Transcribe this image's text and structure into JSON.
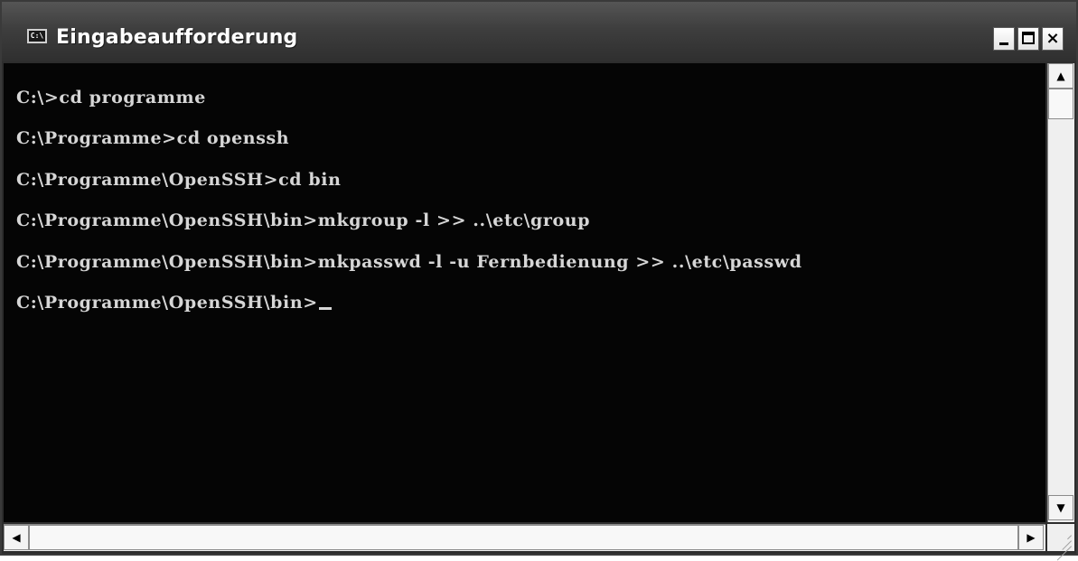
{
  "window": {
    "title": "Eingabeaufforderung",
    "icon_label": "C:\\",
    "controls": {
      "minimize_icon": "minimize-icon",
      "maximize_icon": "maximize-icon",
      "close_icon": "close-icon",
      "close_glyph": "×"
    }
  },
  "console": {
    "lines": [
      "C:\\>cd programme",
      "C:\\Programme>cd openssh",
      "C:\\Programme\\OpenSSH>cd bin",
      "C:\\Programme\\OpenSSH\\bin>mkgroup -l >> ..\\etc\\group",
      "C:\\Programme\\OpenSSH\\bin>mkpasswd -l -u Fernbedienung >> ..\\etc\\passwd",
      "C:\\Programme\\OpenSSH\\bin>"
    ],
    "colors": {
      "background": "#050505",
      "text": "#d6d6d6"
    }
  },
  "scrollbars": {
    "up_glyph": "▲",
    "down_glyph": "▼",
    "left_glyph": "◀",
    "right_glyph": "▶"
  }
}
